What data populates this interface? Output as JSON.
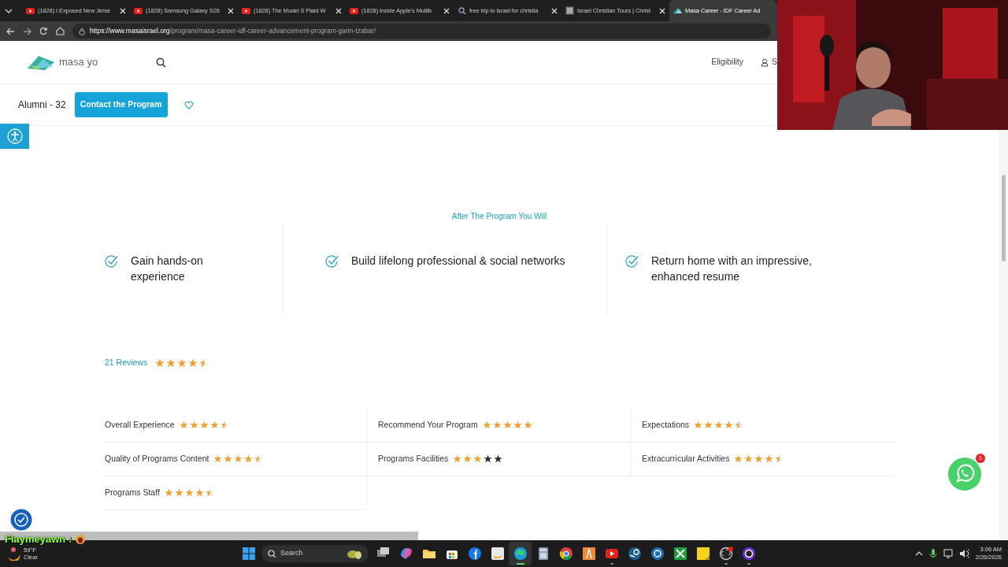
{
  "browser": {
    "tabs": [
      {
        "title": "(1828) I Exposed New Jerse",
        "kind": "video",
        "selected": false
      },
      {
        "title": "(1828) Samsung Galaxy S26",
        "kind": "video",
        "selected": false
      },
      {
        "title": "(1828) The Model S Plaid W",
        "kind": "video",
        "selected": false
      },
      {
        "title": "(1828) Inside Apple's Multib",
        "kind": "video",
        "selected": false
      },
      {
        "title": "free trip to israel for christia",
        "kind": "search",
        "selected": false
      },
      {
        "title": "Israel Christian Tours | Christ",
        "kind": "site",
        "selected": false
      },
      {
        "title": "Masa Career - IDF Career Ad",
        "kind": "masa",
        "selected": true
      }
    ],
    "url_host": "https://www.masaisrael.org",
    "url_path": "/program/masa-career-idf-career-advancement-program-garin-tzabar/"
  },
  "header": {
    "logo_text": "masa yo",
    "nav": [
      "Eligibility"
    ],
    "account": "S"
  },
  "program_bar": {
    "alumni": "Alumni - 32",
    "contact_button": "Contact the Program",
    "saved": false
  },
  "outcomes": {
    "heading": "After The Program You Will",
    "items": [
      "Gain hands-on experience",
      "Build lifelong professional & social networks",
      "Return home with an impressive, enhanced resume"
    ]
  },
  "reviews": {
    "link": "21 Reviews",
    "stars": 4.5,
    "ratings": [
      {
        "label": "Overall Experience",
        "stars": 4.5
      },
      {
        "label": "Recommend Your Program",
        "stars": 5
      },
      {
        "label": "Expectations",
        "stars": 4.5
      },
      {
        "label": "Quality of Programs Content",
        "stars": 4.5
      },
      {
        "label": "Programs Facilities",
        "stars": 3
      },
      {
        "label": "Extracurricular Activities",
        "stars": 4.5
      },
      {
        "label": "Programs Staff",
        "stars": 4.5
      }
    ]
  },
  "whatsapp": {
    "badge": "1"
  },
  "chat": {
    "user": "Flaymeyawn :"
  },
  "taskbar": {
    "weather": {
      "temp": "59°F",
      "condition": "Clear"
    },
    "search": "Search",
    "apps": [
      {
        "kind": "taskview",
        "selected": false,
        "running": false
      },
      {
        "kind": "copilot",
        "selected": false,
        "running": false
      },
      {
        "kind": "folder",
        "selected": false,
        "running": false
      },
      {
        "kind": "store",
        "selected": false,
        "running": false
      },
      {
        "kind": "facebook",
        "selected": false,
        "running": false
      },
      {
        "kind": "amazon",
        "selected": false,
        "running": false
      },
      {
        "kind": "edge",
        "selected": true,
        "running": true
      },
      {
        "kind": "calculator",
        "selected": false,
        "running": false
      },
      {
        "kind": "chrome",
        "selected": false,
        "running": false
      },
      {
        "kind": "orange",
        "selected": false,
        "running": false
      },
      {
        "kind": "youtube",
        "selected": false,
        "running": true
      },
      {
        "kind": "steam",
        "selected": false,
        "running": false
      },
      {
        "kind": "gear",
        "selected": false,
        "running": false
      },
      {
        "kind": "xbox",
        "selected": false,
        "running": false
      },
      {
        "kind": "notes",
        "selected": false,
        "running": false
      },
      {
        "kind": "obs",
        "selected": false,
        "running": true
      },
      {
        "kind": "ring",
        "selected": false,
        "running": true
      }
    ],
    "time": "3:06 AM",
    "date": "2/26/2026"
  }
}
